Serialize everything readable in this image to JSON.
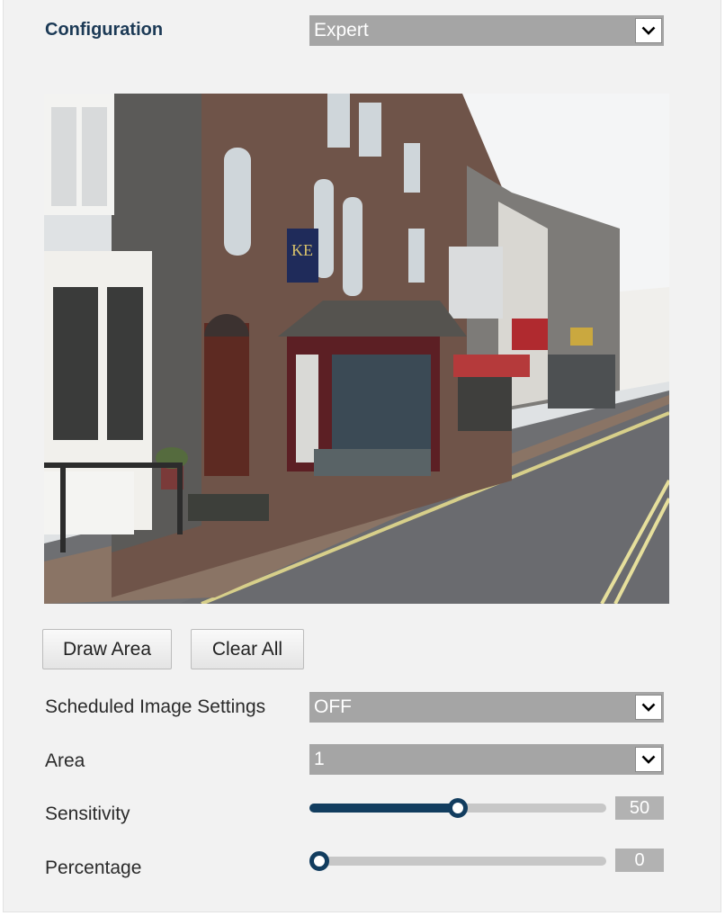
{
  "configuration": {
    "label": "Configuration",
    "mode_value": "Expert"
  },
  "preview": {
    "sign_text": "KE"
  },
  "buttons": {
    "draw_area": "Draw Area",
    "clear_all": "Clear All"
  },
  "scheduled": {
    "label": "Scheduled Image Settings",
    "value": "OFF"
  },
  "area": {
    "label": "Area",
    "value": "1"
  },
  "sensitivity": {
    "label": "Sensitivity",
    "value": "50",
    "level_fraction": 0.5
  },
  "percentage": {
    "label": "Percentage",
    "value": "0",
    "level_fraction": 0.0
  },
  "colors": {
    "accent": "#123d5f",
    "select_bg": "#a5a5a5",
    "heading": "#1c3a56"
  }
}
